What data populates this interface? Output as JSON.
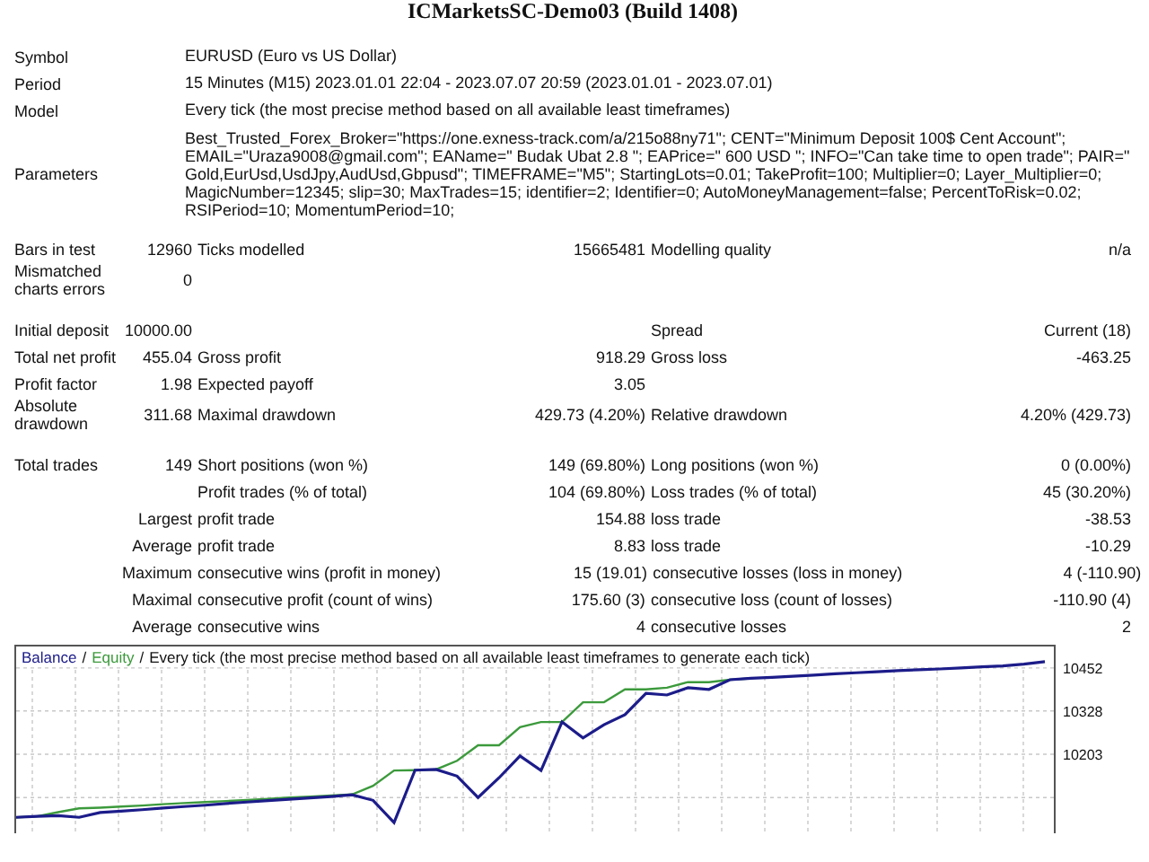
{
  "report_title": "ICMarketsSC-Demo03 (Build 1408)",
  "settings": [
    {
      "label": "Symbol",
      "value": "EURUSD (Euro vs US Dollar)"
    },
    {
      "label": "Period",
      "value": "15 Minutes (M15) 2023.01.01 22:04 - 2023.07.07 20:59 (2023.01.01 - 2023.07.01)"
    },
    {
      "label": "Model",
      "value": "Every tick (the most precise method based on all available least timeframes)"
    },
    {
      "label": "Parameters",
      "value": "Best_Trusted_Forex_Broker=\"https://one.exness-track.com/a/215o88ny71\"; CENT=\"Minimum Deposit 100$ Cent Account\"; EMAIL=\"Uraza9008@gmail.com\"; EAName=\" Budak Ubat 2.8 \"; EAPrice=\" 600 USD \"; INFO=\"Can take time to open trade\"; PAIR=\" Gold,EurUsd,UsdJpy,AudUsd,Gbpusd\"; TIMEFRAME=\"M5\"; StartingLots=0.01; TakeProfit=100; Multiplier=0; Layer_Multiplier=0; MagicNumber=12345; slip=30; MaxTrades=15; identifier=2; Identifier=0; AutoMoneyManagement=false; PercentToRisk=0.02; RSIPeriod=10; MomentumPeriod=10;"
    }
  ],
  "stat_groups": [
    [
      {
        "kind": "stat",
        "col1": {
          "label": "Bars in test",
          "value": "12960"
        },
        "col2": {
          "label": "Ticks modelled",
          "value": "15665481"
        },
        "col3": {
          "label": "Modelling quality",
          "value": "n/a"
        }
      },
      {
        "kind": "stat",
        "col1": {
          "label": "Mismatched charts errors",
          "value": "0"
        }
      }
    ],
    [
      {
        "kind": "stat",
        "col1": {
          "label": "Initial deposit",
          "value": "10000.00"
        },
        "col3": {
          "label": "Spread",
          "value": "Current (18)"
        }
      },
      {
        "kind": "stat",
        "col1": {
          "label": "Total net profit",
          "value": "455.04"
        },
        "col2": {
          "label": "Gross profit",
          "value": "918.29"
        },
        "col3": {
          "label": "Gross loss",
          "value": "-463.25"
        }
      },
      {
        "kind": "stat",
        "col1": {
          "label": "Profit factor",
          "value": "1.98"
        },
        "col2": {
          "label": "Expected payoff",
          "value": "3.05"
        }
      },
      {
        "kind": "stat",
        "col1": {
          "label": "Absolute drawdown",
          "value": "311.68"
        },
        "col2": {
          "label": "Maximal drawdown",
          "value": "429.73 (4.20%)"
        },
        "col3": {
          "label": "Relative drawdown",
          "value": "4.20% (429.73)"
        }
      }
    ],
    [
      {
        "kind": "stat",
        "col1": {
          "label": "Total trades",
          "value": "149"
        },
        "col2": {
          "label": "Short positions (won %)",
          "value": "149 (69.80%)"
        },
        "col3": {
          "label": "Long positions (won %)",
          "value": "0 (0.00%)"
        }
      },
      {
        "kind": "stat",
        "col2": {
          "label": "Profit trades (% of total)",
          "value": "104 (69.80%)"
        },
        "col3": {
          "label": "Loss trades (% of total)",
          "value": "45 (30.20%)"
        }
      },
      {
        "kind": "prefix",
        "col1": {
          "label": "Largest"
        },
        "col2": {
          "label": "profit trade",
          "value": "154.88"
        },
        "col3": {
          "label": "loss trade",
          "value": "-38.53"
        }
      },
      {
        "kind": "prefix",
        "col1": {
          "label": "Average"
        },
        "col2": {
          "label": "profit trade",
          "value": "8.83"
        },
        "col3": {
          "label": "loss trade",
          "value": "-10.29"
        }
      },
      {
        "kind": "prefix",
        "col1": {
          "label": "Maximum"
        },
        "col2": {
          "label": "consecutive wins (profit in money)",
          "value": "15 (19.01)"
        },
        "col3": {
          "label": "consecutive losses (loss in money)",
          "value": "4 (-110.90)"
        }
      },
      {
        "kind": "prefix",
        "col1": {
          "label": "Maximal"
        },
        "col2": {
          "label": "consecutive profit (count of wins)",
          "value": "175.60 (3)"
        },
        "col3": {
          "label": "consecutive loss (count of losses)",
          "value": "-110.90 (4)"
        }
      },
      {
        "kind": "prefix",
        "col1": {
          "label": "Average"
        },
        "col2": {
          "label": "consecutive wins",
          "value": "4"
        },
        "col3": {
          "label": "consecutive losses",
          "value": "2"
        }
      }
    ]
  ],
  "chart": {
    "separator": "/",
    "description": "Every tick (the most precise method based on all available least timeframes to generate each tick)",
    "chart_data": {
      "type": "line",
      "categories": [
        null,
        null,
        null,
        null,
        null,
        null,
        null,
        null,
        null,
        null,
        null,
        null,
        null,
        null,
        null,
        null,
        null,
        null,
        null,
        null,
        null,
        null,
        null,
        null,
        null,
        null,
        null,
        null,
        null,
        null,
        null,
        null,
        null,
        null,
        null,
        null,
        null,
        null,
        null,
        null,
        null,
        null,
        null,
        null,
        null,
        null,
        null,
        null,
        null,
        null
      ],
      "series": [
        {
          "name": "Balance",
          "color": "#1c1c8a",
          "values": [
            10021,
            10024,
            10026,
            10021,
            10035,
            10039,
            10043,
            10048,
            10052,
            10056,
            10061,
            10065,
            10069,
            10073,
            10077,
            10081,
            10086,
            10070,
            10006,
            10157,
            10159,
            10140,
            10078,
            10135,
            10198,
            10156,
            10296,
            10250,
            10288,
            10317,
            10379,
            10374,
            10395,
            10390,
            10418,
            10422,
            10425,
            10428,
            10431,
            10435,
            10438,
            10441,
            10444,
            10447,
            10449,
            10452,
            10455,
            10458,
            10463,
            10470
          ]
        },
        {
          "name": "Equity",
          "color": "#3c9a3c",
          "values": [
            10021,
            10024,
            10036,
            10047,
            10049,
            10052,
            10055,
            10059,
            10062,
            10065,
            10068,
            10071,
            10074,
            10078,
            10081,
            10084,
            10087,
            10112,
            10156,
            10157,
            10159,
            10184,
            10229,
            10229,
            10281,
            10296,
            10296,
            10353,
            10353,
            10390,
            10390,
            10395,
            10411,
            10411,
            10418,
            10422,
            null,
            null,
            null,
            null,
            null,
            null,
            null,
            null,
            null,
            null,
            null,
            null,
            null,
            null
          ]
        }
      ],
      "grid": true,
      "ylim": [
        9975,
        10519
      ],
      "yticks": [
        {
          "value": 10203,
          "label": "10203"
        },
        {
          "value": 10328,
          "label": "10328"
        },
        {
          "value": 10452,
          "label": "10452"
        }
      ]
    }
  }
}
